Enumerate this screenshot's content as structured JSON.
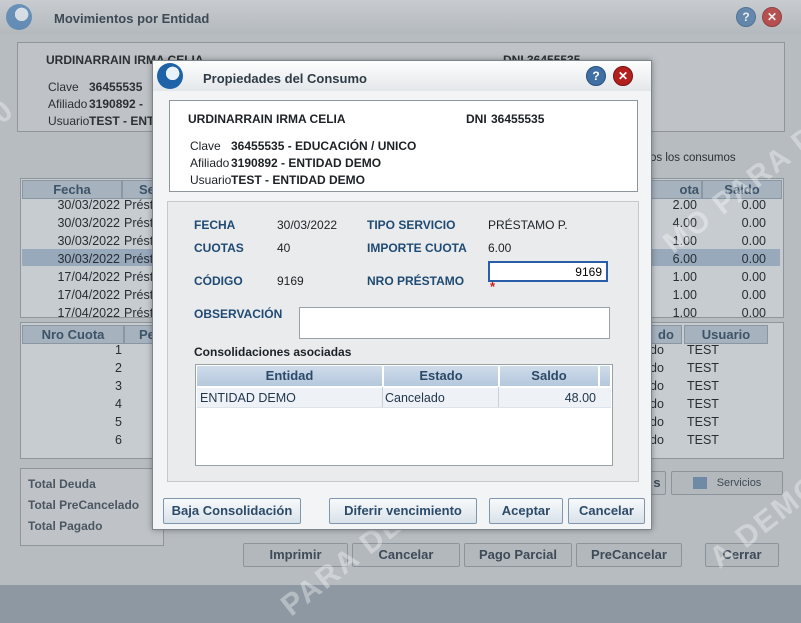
{
  "background_window": {
    "title": "Movimientos por Entidad",
    "header": {
      "name": "URDINARRAIN IRMA CELIA",
      "dni": "DNI  36455535",
      "clave_label": "Clave",
      "clave_value": "36455535",
      "afiliado_label": "Afiliado",
      "afiliado_value": "3190892  -",
      "usuario_label": "Usuario",
      "usuario_value": "TEST  -  ENT"
    },
    "todos_label": "os los consumos",
    "consumos_grid": {
      "col_fecha": "Fecha",
      "col_servicio": "Se",
      "col_cuota": "ota",
      "col_saldo": "Saldo",
      "rows": [
        {
          "fecha": "30/03/2022",
          "servicio": "Prést",
          "cuota": "2.00",
          "saldo": "0.00"
        },
        {
          "fecha": "30/03/2022",
          "servicio": "Prést",
          "cuota": "4.00",
          "saldo": "0.00"
        },
        {
          "fecha": "30/03/2022",
          "servicio": "Prést",
          "cuota": "1.00",
          "saldo": "0.00"
        },
        {
          "fecha": "30/03/2022",
          "servicio": "Prést",
          "cuota": "6.00",
          "saldo": "0.00"
        },
        {
          "fecha": "17/04/2022",
          "servicio": "Prést",
          "cuota": "1.00",
          "saldo": "0.00"
        },
        {
          "fecha": "17/04/2022",
          "servicio": "Prést",
          "cuota": "1.00",
          "saldo": "0.00"
        },
        {
          "fecha": "17/04/2022",
          "servicio": "Prést",
          "cuota": "1.00",
          "saldo": "0.00"
        }
      ]
    },
    "cuotas_grid": {
      "col_nro": "Nro Cuota",
      "col_pe": "Pe",
      "col_do": "do",
      "col_usuario": "Usuario",
      "rows": [
        {
          "nro": "1",
          "do": "do",
          "usuario": "TEST"
        },
        {
          "nro": "2",
          "do": "do",
          "usuario": "TEST"
        },
        {
          "nro": "3",
          "do": "do",
          "usuario": "TEST"
        },
        {
          "nro": "4",
          "do": "do",
          "usuario": "TEST"
        },
        {
          "nro": "5",
          "do": "do",
          "usuario": "TEST"
        },
        {
          "nro": "6",
          "do": "do",
          "usuario": "TEST"
        }
      ]
    },
    "totals": {
      "deuda": "Total Deuda",
      "precancelado": "Total PreCancelado",
      "pagado": "Total Pagado"
    },
    "side_buttons": {
      "s": "s",
      "servicios": "Servicios"
    },
    "buttons": {
      "imprimir": "Imprimir",
      "cancelar": "Cancelar",
      "pago_parcial": "Pago Parcial",
      "precancelar": "PreCancelar",
      "cerrar": "Cerrar"
    },
    "watermarks": [
      "0",
      "MO PARA DEMO",
      "PARA DE",
      "A DEMO",
      "DEMO"
    ]
  },
  "modal": {
    "title": "Propiedades del Consumo",
    "header": {
      "name": "URDINARRAIN IRMA CELIA",
      "dni_label": "DNI",
      "dni_value": "36455535",
      "clave_label": "Clave",
      "clave_value": "36455535  -  EDUCACIÓN / UNICO",
      "afiliado_label": "Afiliado",
      "afiliado_value": "3190892  -  ENTIDAD DEMO",
      "usuario_label": "Usuario",
      "usuario_value": "TEST  -  ENTIDAD DEMO"
    },
    "fields": {
      "fecha_label": "FECHA",
      "fecha_value": "30/03/2022",
      "tipo_servicio_label": "TIPO SERVICIO",
      "tipo_servicio_value": "PRÉSTAMO P.",
      "cuotas_label": "CUOTAS",
      "cuotas_value": "40",
      "importe_cuota_label": "IMPORTE CUOTA",
      "importe_cuota_value": "6.00",
      "codigo_label": "CÓDIGO",
      "codigo_value": "9169",
      "nro_prestamo_label": "NRO PRÉSTAMO",
      "nro_prestamo_value": "9169",
      "required_mark": "*",
      "observacion_label": "OBSERVACIÓN",
      "observacion_value": ""
    },
    "consolidaciones": {
      "title": "Consolidaciones asociadas",
      "col_entidad": "Entidad",
      "col_estado": "Estado",
      "col_saldo": "Saldo",
      "rows": [
        {
          "entidad": "ENTIDAD DEMO",
          "estado": "Cancelado",
          "saldo": "48.00"
        }
      ]
    },
    "buttons": {
      "baja_consolidacion": "Baja Consolidación",
      "diferir_vencimiento": "Diferir vencimiento",
      "aceptar": "Aceptar",
      "cancelar": "Cancelar"
    }
  },
  "colors": {
    "accent": "#2a5da8",
    "selected_row": "#9fb4cc",
    "close_icon": "#b31f1f"
  }
}
